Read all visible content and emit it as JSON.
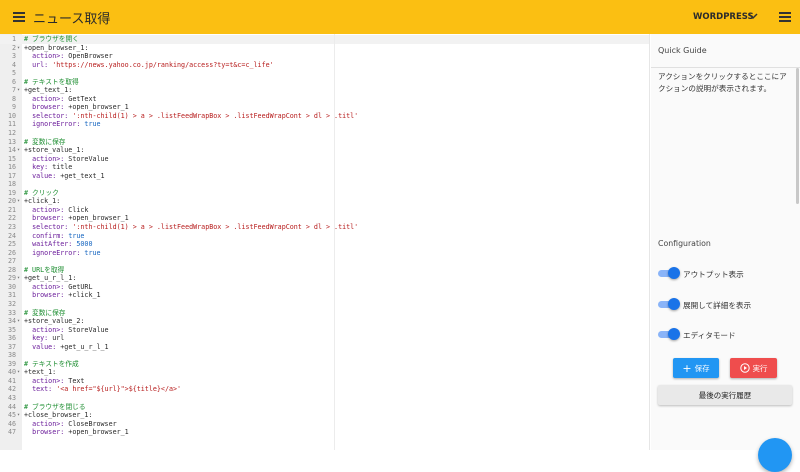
{
  "header": {
    "title": "ニュース取得",
    "platform": "WORDPRESS",
    "menu_icon": "menu-icon",
    "dropdown_icon": "chevron-down-icon",
    "right_menu_icon": "menu-icon"
  },
  "editor": {
    "lines": [
      [
        {
          "t": "comment",
          "v": "# ブラウザを開く"
        }
      ],
      [
        {
          "t": "plain",
          "v": "+open_browser_1:"
        }
      ],
      [
        {
          "t": "plain",
          "v": "  "
        },
        {
          "t": "key",
          "v": "action>:"
        },
        {
          "t": "plain",
          "v": " OpenBrowser"
        }
      ],
      [
        {
          "t": "plain",
          "v": "  "
        },
        {
          "t": "key",
          "v": "url:"
        },
        {
          "t": "plain",
          "v": " "
        },
        {
          "t": "str",
          "v": "'https://news.yahoo.co.jp/ranking/access?ty=t&c=c_life'"
        }
      ],
      [],
      [
        {
          "t": "comment",
          "v": "# テキストを取得"
        }
      ],
      [
        {
          "t": "plain",
          "v": "+get_text_1:"
        }
      ],
      [
        {
          "t": "plain",
          "v": "  "
        },
        {
          "t": "key",
          "v": "action>:"
        },
        {
          "t": "plain",
          "v": " GetText"
        }
      ],
      [
        {
          "t": "plain",
          "v": "  "
        },
        {
          "t": "key",
          "v": "browser:"
        },
        {
          "t": "plain",
          "v": " +open_browser_1"
        }
      ],
      [
        {
          "t": "plain",
          "v": "  "
        },
        {
          "t": "key",
          "v": "selector:"
        },
        {
          "t": "plain",
          "v": " "
        },
        {
          "t": "str",
          "v": "':nth-child(1) > a > .listFeedWrapBox > .listFeedWrapCont > dl > .titl'"
        }
      ],
      [
        {
          "t": "plain",
          "v": "  "
        },
        {
          "t": "key",
          "v": "ignoreError:"
        },
        {
          "t": "plain",
          "v": " "
        },
        {
          "t": "bool",
          "v": "true"
        }
      ],
      [],
      [
        {
          "t": "comment",
          "v": "# 変数に保存"
        }
      ],
      [
        {
          "t": "plain",
          "v": "+store_value_1:"
        }
      ],
      [
        {
          "t": "plain",
          "v": "  "
        },
        {
          "t": "key",
          "v": "action>:"
        },
        {
          "t": "plain",
          "v": " StoreValue"
        }
      ],
      [
        {
          "t": "plain",
          "v": "  "
        },
        {
          "t": "key",
          "v": "key:"
        },
        {
          "t": "plain",
          "v": " title"
        }
      ],
      [
        {
          "t": "plain",
          "v": "  "
        },
        {
          "t": "key",
          "v": "value:"
        },
        {
          "t": "plain",
          "v": " +get_text_1"
        }
      ],
      [],
      [
        {
          "t": "comment",
          "v": "# クリック"
        }
      ],
      [
        {
          "t": "plain",
          "v": "+click_1:"
        }
      ],
      [
        {
          "t": "plain",
          "v": "  "
        },
        {
          "t": "key",
          "v": "action>:"
        },
        {
          "t": "plain",
          "v": " Click"
        }
      ],
      [
        {
          "t": "plain",
          "v": "  "
        },
        {
          "t": "key",
          "v": "browser:"
        },
        {
          "t": "plain",
          "v": " +open_browser_1"
        }
      ],
      [
        {
          "t": "plain",
          "v": "  "
        },
        {
          "t": "key",
          "v": "selector:"
        },
        {
          "t": "plain",
          "v": " "
        },
        {
          "t": "str",
          "v": "':nth-child(1) > a > .listFeedWrapBox > .listFeedWrapCont > dl > .titl'"
        }
      ],
      [
        {
          "t": "plain",
          "v": "  "
        },
        {
          "t": "key",
          "v": "confirm:"
        },
        {
          "t": "plain",
          "v": " "
        },
        {
          "t": "bool",
          "v": "true"
        }
      ],
      [
        {
          "t": "plain",
          "v": "  "
        },
        {
          "t": "key",
          "v": "waitAfter:"
        },
        {
          "t": "plain",
          "v": " "
        },
        {
          "t": "num",
          "v": "5000"
        }
      ],
      [
        {
          "t": "plain",
          "v": "  "
        },
        {
          "t": "key",
          "v": "ignoreError:"
        },
        {
          "t": "plain",
          "v": " "
        },
        {
          "t": "bool",
          "v": "true"
        }
      ],
      [],
      [
        {
          "t": "comment",
          "v": "# URLを取得"
        }
      ],
      [
        {
          "t": "plain",
          "v": "+get_u_r_l_1:"
        }
      ],
      [
        {
          "t": "plain",
          "v": "  "
        },
        {
          "t": "key",
          "v": "action>:"
        },
        {
          "t": "plain",
          "v": " GetURL"
        }
      ],
      [
        {
          "t": "plain",
          "v": "  "
        },
        {
          "t": "key",
          "v": "browser:"
        },
        {
          "t": "plain",
          "v": " +click_1"
        }
      ],
      [],
      [
        {
          "t": "comment",
          "v": "# 変数に保存"
        }
      ],
      [
        {
          "t": "plain",
          "v": "+store_value_2:"
        }
      ],
      [
        {
          "t": "plain",
          "v": "  "
        },
        {
          "t": "key",
          "v": "action>:"
        },
        {
          "t": "plain",
          "v": " StoreValue"
        }
      ],
      [
        {
          "t": "plain",
          "v": "  "
        },
        {
          "t": "key",
          "v": "key:"
        },
        {
          "t": "plain",
          "v": " url"
        }
      ],
      [
        {
          "t": "plain",
          "v": "  "
        },
        {
          "t": "key",
          "v": "value:"
        },
        {
          "t": "plain",
          "v": " +get_u_r_l_1"
        }
      ],
      [],
      [
        {
          "t": "comment",
          "v": "# テキストを作成"
        }
      ],
      [
        {
          "t": "plain",
          "v": "+text_1:"
        }
      ],
      [
        {
          "t": "plain",
          "v": "  "
        },
        {
          "t": "key",
          "v": "action>:"
        },
        {
          "t": "plain",
          "v": " Text"
        }
      ],
      [
        {
          "t": "plain",
          "v": "  "
        },
        {
          "t": "key",
          "v": "text:"
        },
        {
          "t": "plain",
          "v": " "
        },
        {
          "t": "str",
          "v": "'<a href=\"${url}\">${title}</a>'"
        }
      ],
      [],
      [
        {
          "t": "comment",
          "v": "# ブラウザを閉じる"
        }
      ],
      [
        {
          "t": "plain",
          "v": "+close_browser_1:"
        }
      ],
      [
        {
          "t": "plain",
          "v": "  "
        },
        {
          "t": "key",
          "v": "action>:"
        },
        {
          "t": "plain",
          "v": " CloseBrowser"
        }
      ],
      [
        {
          "t": "plain",
          "v": "  "
        },
        {
          "t": "key",
          "v": "browser:"
        },
        {
          "t": "plain",
          "v": " +open_browser_1"
        }
      ]
    ],
    "fold_lines": [
      2,
      7,
      14,
      20,
      29,
      34,
      40,
      45
    ],
    "fold_icon": "fold-arrow-icon"
  },
  "guide": {
    "title": "Quick Guide",
    "text": "アクションをクリックするとここにアクションの説明が表示されます。"
  },
  "config": {
    "title": "Configuration",
    "toggles": [
      {
        "label": "アウトプット表示",
        "on": true
      },
      {
        "label": "展開して詳細を表示",
        "on": true
      },
      {
        "label": "エディタモード",
        "on": true
      }
    ],
    "save_label": "保存",
    "run_label": "実行",
    "history_label": "最後の実行履歴",
    "save_icon": "plus-icon",
    "run_icon": "play-circle-icon"
  },
  "colors": {
    "header": "#fbbf12",
    "accent": "#1a73e8",
    "save": "#2196f3",
    "run": "#ef4d4d"
  }
}
